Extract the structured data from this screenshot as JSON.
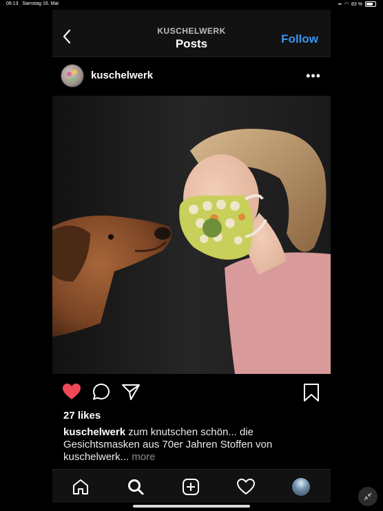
{
  "status_bar": {
    "time": "06:13",
    "date": "Samstag 16. Mai",
    "battery": "83 %",
    "battery_icon": "battery-icon",
    "wifi_icon": "wifi-icon",
    "signal_icon": "signal-icon"
  },
  "nav": {
    "subtitle": "KUSCHELWERK",
    "title": "Posts",
    "follow_label": "Follow",
    "accent_color": "#3897f0"
  },
  "post": {
    "username": "kuschelwerk",
    "more_icon": "more-horizontal-icon",
    "image": {
      "subject": "dog and woman wearing a patterned face mask facing each other"
    },
    "likes": "27 likes",
    "caption_username": "kuschelwerk",
    "caption_text": "zum knutschen schön... die Gesichtsmasken aus 70er Jahren Stoffen von kuschelwerk...",
    "caption_more": "more",
    "like_color": "#ed4956"
  },
  "actions": {
    "like_icon": "heart-filled-icon",
    "comment_icon": "comment-icon",
    "share_icon": "send-icon",
    "save_icon": "bookmark-icon"
  },
  "tabbar": {
    "items": [
      "home-icon",
      "search-icon",
      "add-post-icon",
      "activity-heart-icon",
      "profile-avatar"
    ]
  }
}
